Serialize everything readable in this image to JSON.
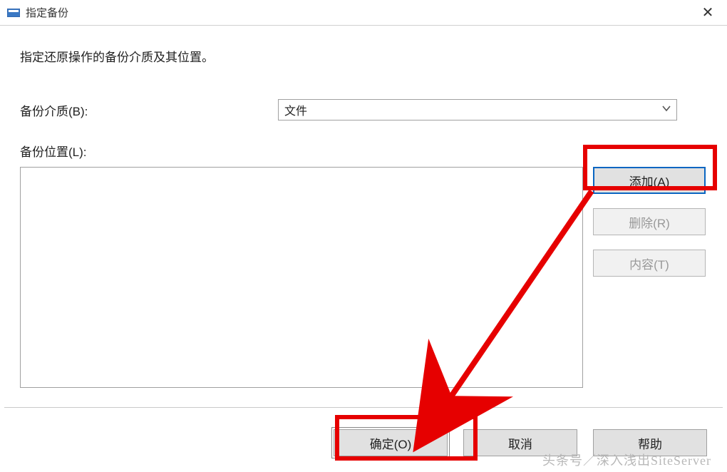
{
  "window": {
    "title": "指定备份",
    "close_label": "✕"
  },
  "body": {
    "instruction": "指定还原操作的备份介质及其位置。",
    "media": {
      "label": "备份介质(B):",
      "selected": "文件"
    },
    "location": {
      "label": "备份位置(L):"
    },
    "side_buttons": {
      "add": "添加(A)",
      "delete": "删除(R)",
      "content": "内容(T)"
    }
  },
  "footer": {
    "ok": "确定(O)",
    "cancel": "取消",
    "help": "帮助"
  },
  "watermark": "头条号／深入浅出SiteServer"
}
